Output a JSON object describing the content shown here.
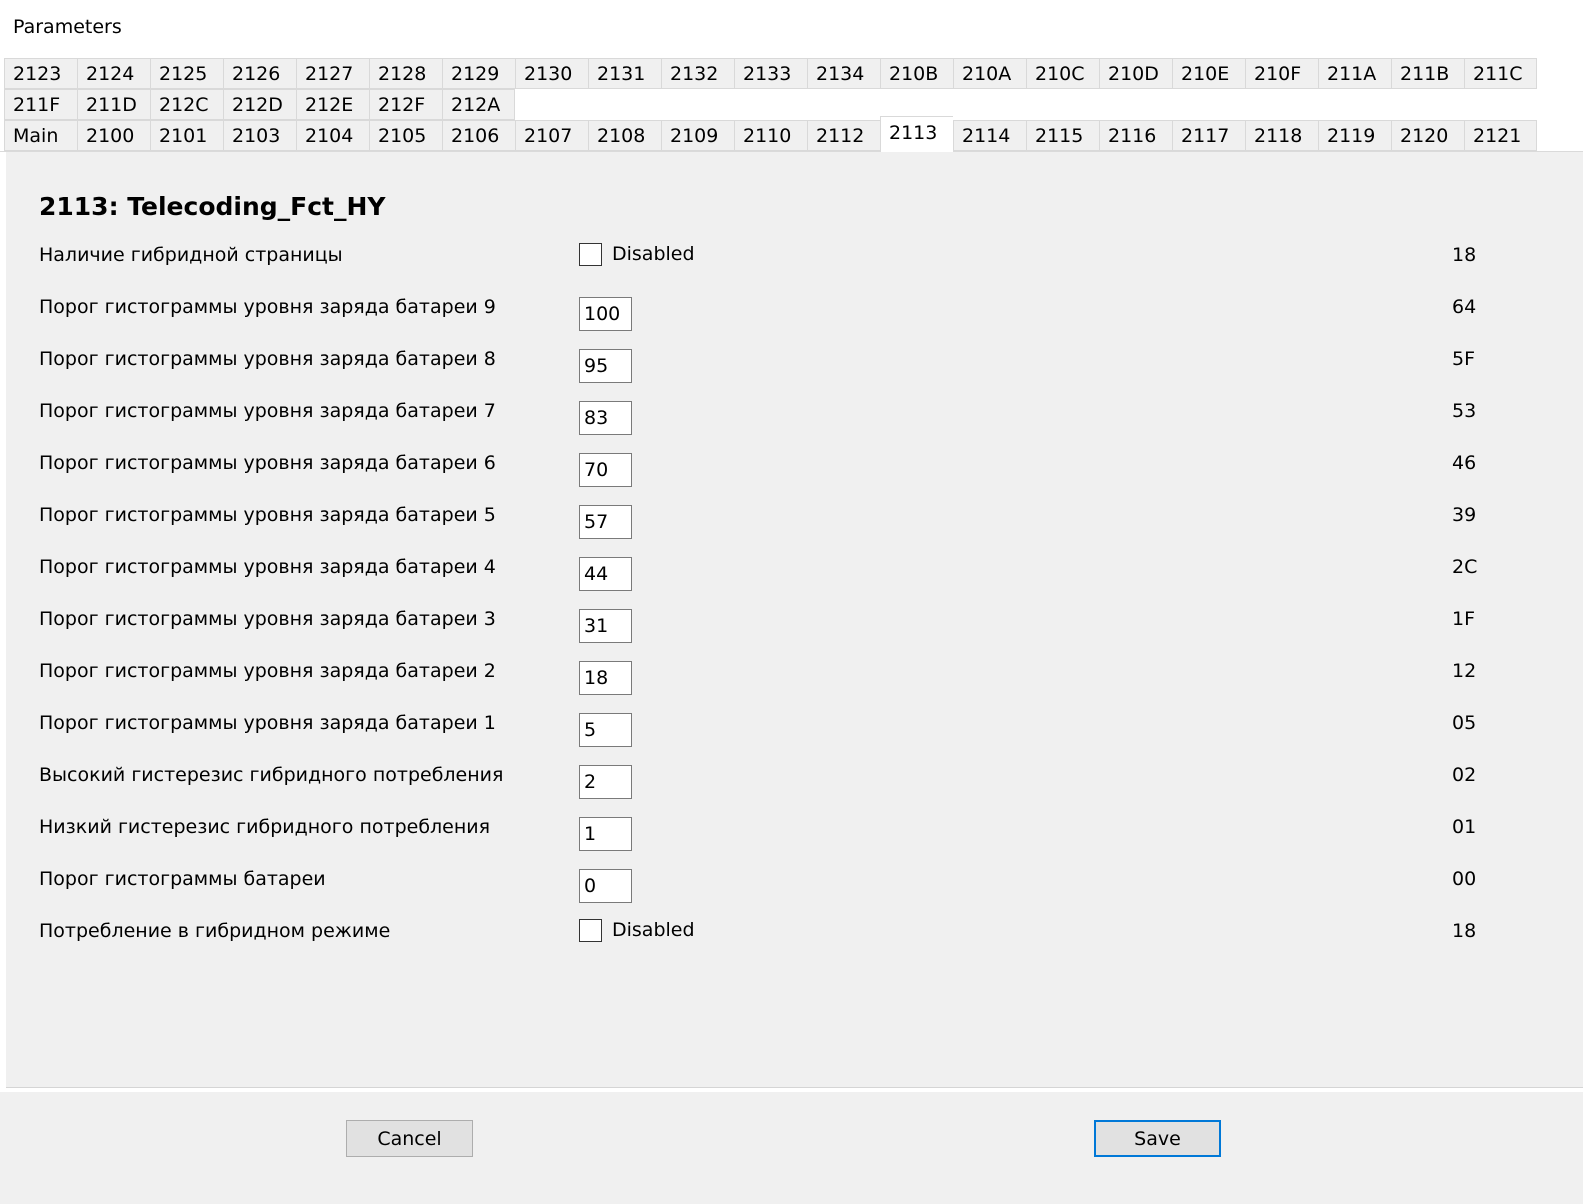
{
  "window": {
    "title": "Parameters"
  },
  "tabs": {
    "row1": [
      "2123",
      "2124",
      "2125",
      "2126",
      "2127",
      "2128",
      "2129",
      "2130",
      "2131",
      "2132",
      "2133",
      "2134",
      "210B",
      "210A",
      "210C",
      "210D",
      "210E",
      "210F",
      "211A",
      "211B",
      "211C"
    ],
    "row2": [
      "211F",
      "211D",
      "212C",
      "212D",
      "212E",
      "212F",
      "212A"
    ],
    "row3": [
      "Main",
      "2100",
      "2101",
      "2103",
      "2104",
      "2105",
      "2106",
      "2107",
      "2108",
      "2109",
      "2110",
      "2112",
      "2113",
      "2114",
      "2115",
      "2116",
      "2117",
      "2118",
      "2119",
      "2120",
      "2121"
    ],
    "active": "2113"
  },
  "page": {
    "title": "2113: Telecoding_Fct_HY",
    "fields": [
      {
        "label": "Наличие гибридной страницы",
        "type": "checkbox",
        "checked": false,
        "text": "Disabled",
        "hex": "18"
      },
      {
        "label": "Порог гистограммы уровня заряда батареи 9",
        "type": "input",
        "value": "100",
        "hex": "64"
      },
      {
        "label": "Порог гистограммы уровня заряда батареи 8",
        "type": "input",
        "value": "95",
        "hex": "5F"
      },
      {
        "label": "Порог гистограммы уровня заряда батареи 7",
        "type": "input",
        "value": "83",
        "hex": "53"
      },
      {
        "label": "Порог гистограммы уровня заряда батареи 6",
        "type": "input",
        "value": "70",
        "hex": "46"
      },
      {
        "label": "Порог гистограммы уровня заряда батареи 5",
        "type": "input",
        "value": "57",
        "hex": "39"
      },
      {
        "label": "Порог гистограммы уровня заряда батареи 4",
        "type": "input",
        "value": "44",
        "hex": "2C"
      },
      {
        "label": "Порог гистограммы уровня заряда батареи 3",
        "type": "input",
        "value": "31",
        "hex": "1F"
      },
      {
        "label": "Порог гистограммы уровня заряда батареи 2",
        "type": "input",
        "value": "18",
        "hex": "12"
      },
      {
        "label": "Порог гистограммы уровня заряда батареи 1",
        "type": "input",
        "value": "5",
        "hex": "05"
      },
      {
        "label": "Высокий гистерезис гибридного потребления",
        "type": "input",
        "value": "2",
        "hex": "02"
      },
      {
        "label": "Низкий гистерезис гибридного потребления",
        "type": "input",
        "value": "1",
        "hex": "01"
      },
      {
        "label": "Порог гистограммы батареи",
        "type": "input",
        "value": "0",
        "hex": "00"
      },
      {
        "label": "Потребление в гибридном режиме",
        "type": "checkbox",
        "checked": false,
        "text": "Disabled",
        "hex": "18"
      }
    ]
  },
  "footer": {
    "cancel_label": "Cancel",
    "save_label": "Save"
  },
  "colors": {
    "panel_bg": "#f0f0f0",
    "default_button_border": "#0078d7"
  }
}
